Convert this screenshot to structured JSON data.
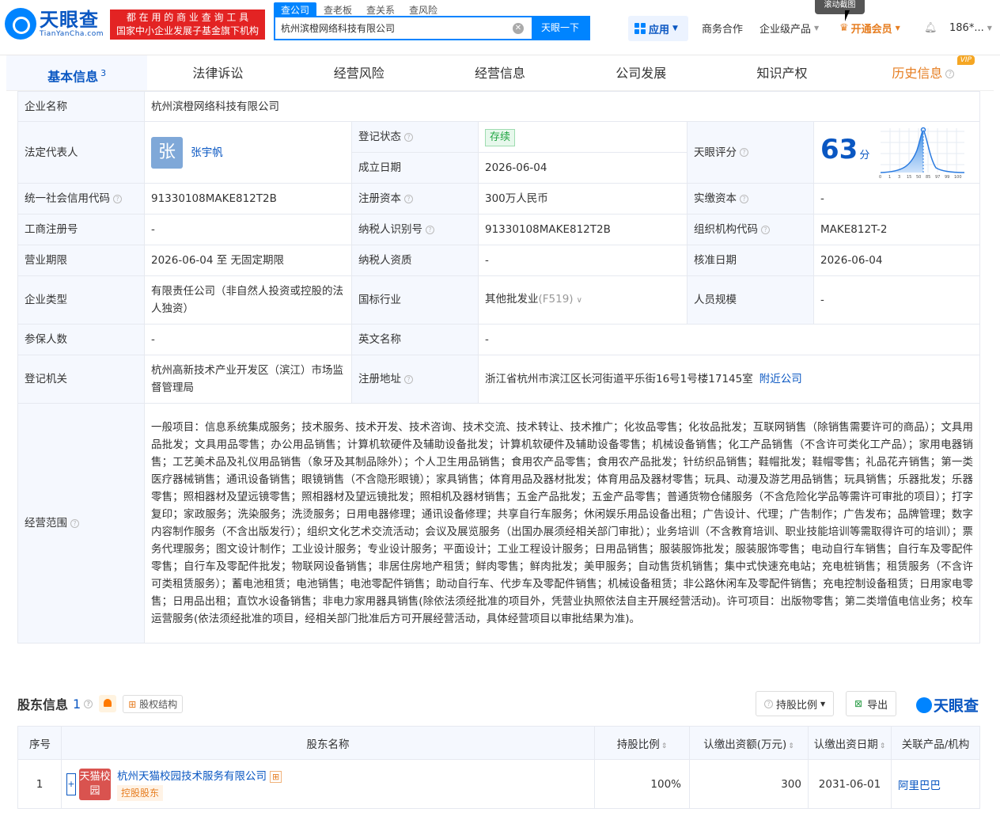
{
  "header": {
    "logo_cn": "天眼查",
    "logo_en": "TianYanCha.com",
    "slogan_line1": "都 在 用 的 商 业 查 询 工 具",
    "slogan_line2": "国家中小企业发展子基金旗下机构",
    "search_tabs": [
      "查公司",
      "查老板",
      "查关系",
      "查风险"
    ],
    "search_value": "杭州滨橙网络科技有限公司",
    "search_button": "天眼一下",
    "app_label": "应用",
    "nav": [
      "商务合作",
      "企业级产品",
      "开通会员",
      "186*..."
    ],
    "tooltip": "滚动截图"
  },
  "tabs": [
    {
      "label": "基本信息",
      "count": "3"
    },
    {
      "label": "法律诉讼"
    },
    {
      "label": "经营风险"
    },
    {
      "label": "经营信息"
    },
    {
      "label": "公司发展"
    },
    {
      "label": "知识产权"
    },
    {
      "label": "历史信息",
      "vip": "VIP"
    }
  ],
  "info": {
    "name_k": "企业名称",
    "name_v": "杭州滨橙网络科技有限公司",
    "legal_k": "法定代表人",
    "legal_avatar": "张",
    "legal_v": "张宇帆",
    "status_k": "登记状态",
    "status_v": "存续",
    "found_k": "成立日期",
    "found_v": "2026-06-04",
    "score_k": "天眼评分",
    "score_v": "63",
    "score_unit": "分",
    "score_ticks": [
      "0",
      "1",
      "3",
      "15",
      "50",
      "85",
      "97",
      "99",
      "100"
    ],
    "credit_k": "统一社会信用代码",
    "credit_v": "91330108MAKE812T2B",
    "capital_k": "注册资本",
    "capital_v": "300万人民币",
    "paid_k": "实缴资本",
    "paid_v": "-",
    "reg_k": "工商注册号",
    "reg_v": "-",
    "tax_k": "纳税人识别号",
    "tax_v": "91330108MAKE812T2B",
    "org_k": "组织机构代码",
    "org_v": "MAKE812T-2",
    "term_k": "营业期限",
    "term_v": "2026-06-04 至 无固定期限",
    "taxq_k": "纳税人资质",
    "taxq_v": "-",
    "approve_k": "核准日期",
    "approve_v": "2026-06-04",
    "type_k": "企业类型",
    "type_v": "有限责任公司（非自然人投资或控股的法人独资）",
    "industry_k": "国标行业",
    "industry_v": "其他批发业",
    "industry_code": "(F519)",
    "staff_k": "人员规模",
    "staff_v": "-",
    "insured_k": "参保人数",
    "insured_v": "-",
    "en_k": "英文名称",
    "en_v": "-",
    "authority_k": "登记机关",
    "authority_v": "杭州高新技术产业开发区（滨江）市场监督管理局",
    "addr_k": "注册地址",
    "addr_v": "浙江省杭州市滨江区长河街道平乐街16号1号楼17145室",
    "addr_link": "附近公司",
    "scope_k": "经营范围",
    "scope_v": "一般项目：信息系统集成服务；技术服务、技术开发、技术咨询、技术交流、技术转让、技术推广；化妆品零售；化妆品批发；互联网销售（除销售需要许可的商品）；文具用品批发；文具用品零售；办公用品销售；计算机软硬件及辅助设备批发；计算机软硬件及辅助设备零售；机械设备销售；化工产品销售（不含许可类化工产品）；家用电器销售；工艺美术品及礼仪用品销售（象牙及其制品除外）；个人卫生用品销售；食用农产品零售；食用农产品批发；针纺织品销售；鞋帽批发；鞋帽零售；礼品花卉销售；第一类医疗器械销售；通讯设备销售；眼镜销售（不含隐形眼镜）；家具销售；体育用品及器材批发；体育用品及器材零售；玩具、动漫及游艺用品销售；玩具销售；乐器批发；乐器零售；照相器材及望远镜零售；照相器材及望远镜批发；照相机及器材销售；五金产品批发；五金产品零售；普通货物仓储服务（不含危险化学品等需许可审批的项目）；打字复印；家政服务；洗染服务；洗烫服务；日用电器修理；通讯设备修理；共享自行车服务；休闲娱乐用品设备出租；广告设计、代理；广告制作；广告发布；品牌管理；数字内容制作服务（不含出版发行）；组织文化艺术交流活动；会议及展览服务（出国办展须经相关部门审批）；业务培训（不含教育培训、职业技能培训等需取得许可的培训）；票务代理服务；图文设计制作；工业设计服务；专业设计服务；平面设计；工业工程设计服务；日用品销售；服装服饰批发；服装服饰零售；电动自行车销售；自行车及零配件零售；自行车及零配件批发；物联网设备销售；非居住房地产租赁；鲜肉零售；鲜肉批发；美甲服务；自动售货机销售；集中式快速充电站；充电桩销售；租赁服务（不含许可类租赁服务）；蓄电池租赁；电池销售；电池零配件销售；助动自行车、代步车及零配件销售；机械设备租赁；非公路休闲车及零配件销售；充电控制设备租赁；日用家电零售；日用品出租；直饮水设备销售；非电力家用器具销售(除依法须经批准的项目外，凭营业执照依法自主开展经营活动)。许可项目：出版物零售；第二类增值电信业务；校车运营服务(依法须经批准的项目，经相关部门批准后方可开展经营活动，具体经营项目以审批结果为准)。"
  },
  "shareholders": {
    "title": "股东信息",
    "count": "1",
    "equity_btn": "股权结构",
    "ratio_btn": "持股比例",
    "export_btn": "导出",
    "brand": "天眼查",
    "headers": [
      "序号",
      "股东名称",
      "持股比例",
      "认缴出资额(万元)",
      "认缴出资日期",
      "关联产品/机构"
    ],
    "rows": [
      {
        "idx": "1",
        "logo": "天猫校园",
        "name": "杭州天猫校园技术服务有限公司",
        "tag": "控股股东",
        "ratio": "100%",
        "amount": "300",
        "date": "2031-06-01",
        "product": "阿里巴巴"
      }
    ]
  }
}
